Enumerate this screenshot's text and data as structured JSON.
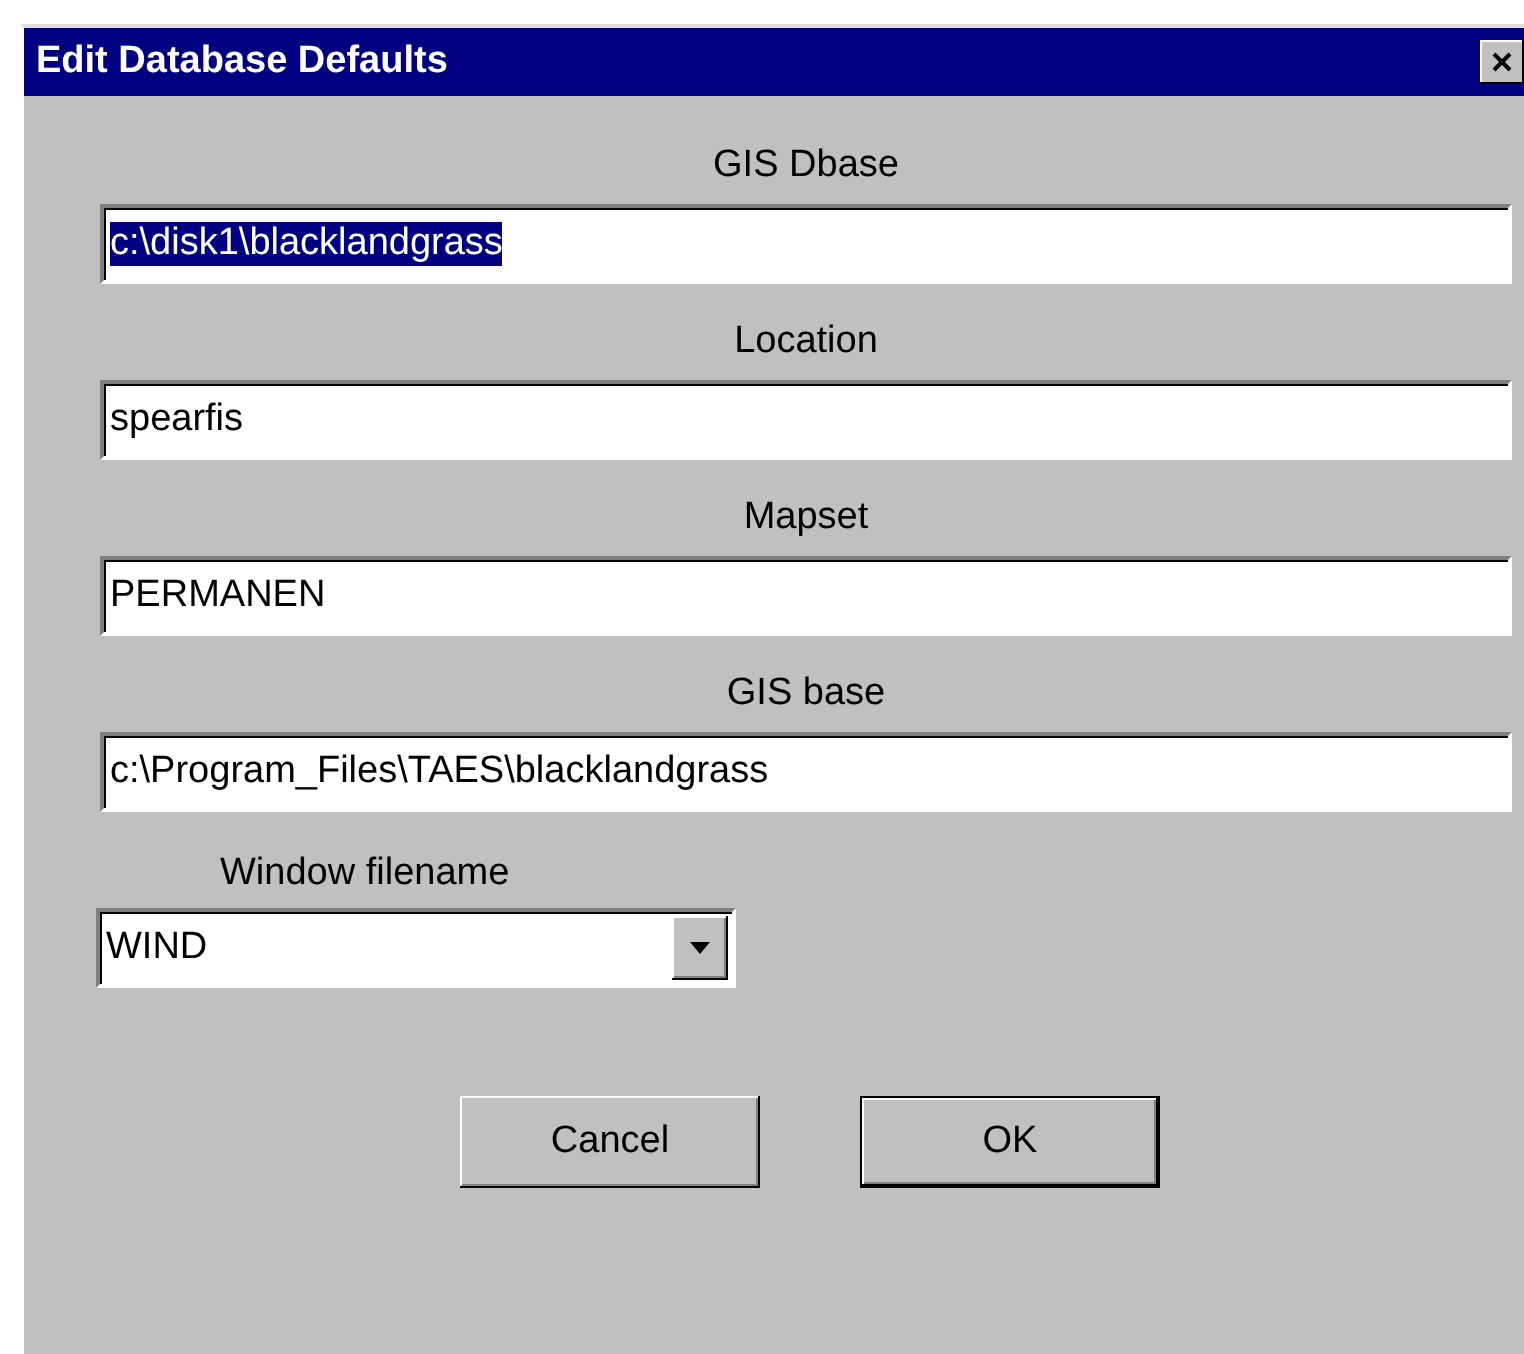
{
  "window": {
    "title": "Edit Database Defaults"
  },
  "fields": [
    {
      "label": "GIS Dbase",
      "value": "c:\\disk1\\blacklandgrass",
      "text_selected": true
    },
    {
      "label": "Location",
      "value": "spearfis",
      "text_selected": false
    },
    {
      "label": "Mapset",
      "value": "PERMANEN",
      "text_selected": false
    },
    {
      "label": "GIS base",
      "value": "c:\\Program_Files\\TAES\\blacklandgrass",
      "text_selected": false
    }
  ],
  "dropdown": {
    "label": "Window filename",
    "value": "WIND"
  },
  "buttons": [
    {
      "label": "Cancel",
      "default": false
    },
    {
      "label": "OK",
      "default": true
    }
  ]
}
